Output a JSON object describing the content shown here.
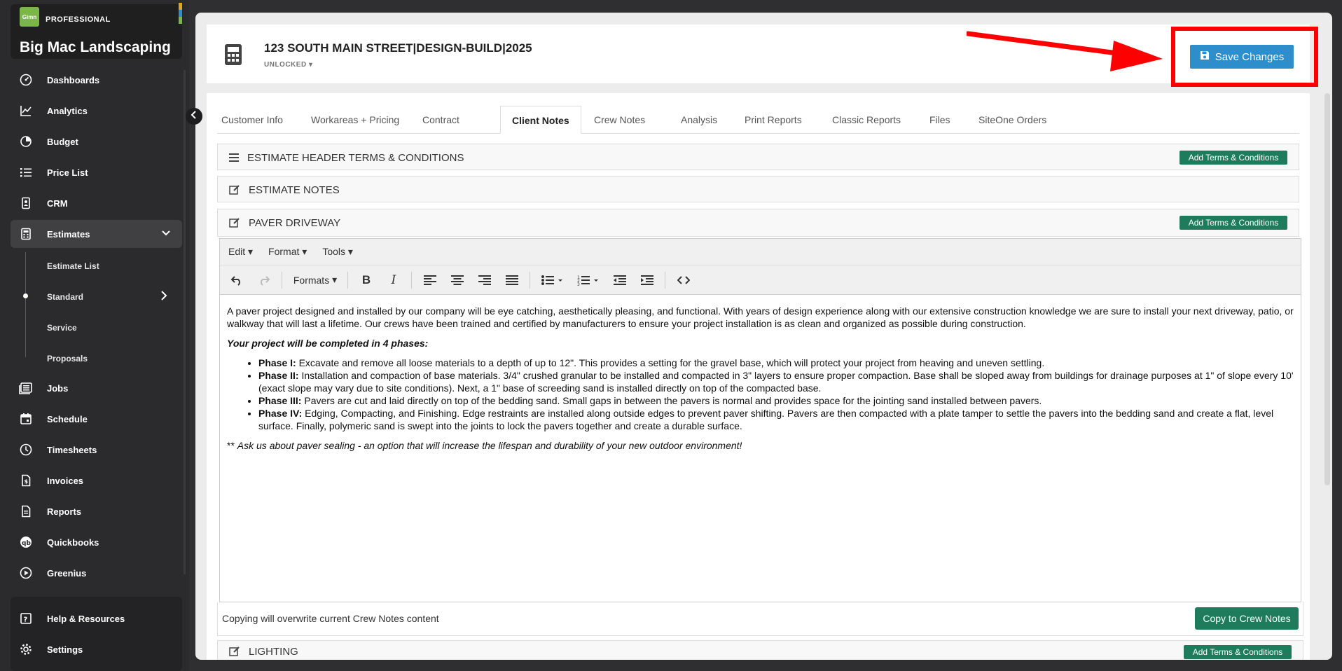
{
  "brand": {
    "logo_text": "Gimn",
    "tier": "PROFESSIONAL",
    "company": "Big Mac Landscaping",
    "colors": [
      "#e7a21b",
      "#2e8dcb",
      "#7ab648"
    ]
  },
  "nav": {
    "items": [
      {
        "label": "Dashboards",
        "icon": "gauge-icon"
      },
      {
        "label": "Analytics",
        "icon": "line-chart-icon"
      },
      {
        "label": "Budget",
        "icon": "pie-chart-icon"
      },
      {
        "label": "Price List",
        "icon": "list-icon"
      },
      {
        "label": "CRM",
        "icon": "contact-icon"
      },
      {
        "label": "Estimates",
        "icon": "calculator-icon"
      },
      {
        "label": "Jobs",
        "icon": "stack-icon"
      },
      {
        "label": "Schedule",
        "icon": "calendar-icon"
      },
      {
        "label": "Timesheets",
        "icon": "clock-icon"
      },
      {
        "label": "Invoices",
        "icon": "invoice-icon"
      },
      {
        "label": "Reports",
        "icon": "report-icon"
      },
      {
        "label": "Quickbooks",
        "icon": "quickbooks-icon"
      },
      {
        "label": "Greenius",
        "icon": "play-circle-icon"
      }
    ],
    "estimate_sub": [
      "Estimate List",
      "Standard",
      "Service",
      "Proposals"
    ],
    "bottom": [
      {
        "label": "Help & Resources",
        "icon": "help-icon"
      },
      {
        "label": "Settings",
        "icon": "gear-icon"
      }
    ]
  },
  "header": {
    "title": "123 SOUTH MAIN STREET|DESIGN-BUILD|2025",
    "status": "UNLOCKED",
    "save_label": "Save Changes"
  },
  "tabs": [
    {
      "label": "Customer Info"
    },
    {
      "label": "Workareas + Pricing"
    },
    {
      "label": "Contract"
    },
    {
      "label": "Client Notes"
    },
    {
      "label": "Crew Notes"
    },
    {
      "label": "Analysis"
    },
    {
      "label": "Print Reports"
    },
    {
      "label": "Classic Reports"
    },
    {
      "label": "Files"
    },
    {
      "label": "SiteOne Orders"
    }
  ],
  "sections": {
    "terms": {
      "title": "ESTIMATE HEADER TERMS & CONDITIONS",
      "button": "Add Terms & Conditions"
    },
    "notes": {
      "title": "ESTIMATE NOTES"
    },
    "paver": {
      "title": "PAVER DRIVEWAY",
      "button": "Add Terms & Conditions"
    },
    "lighting": {
      "title": "LIGHTING",
      "button": "Add Terms & Conditions"
    }
  },
  "editor": {
    "menus": [
      "Edit",
      "Format",
      "Tools"
    ],
    "formats_label": "Formats",
    "intro": "A paver project designed and installed by our company will be eye catching, aesthetically pleasing, and functional. With years of design experience along with our extensive construction knowledge we are sure to install your next driveway, patio, or walkway that will last a lifetime.  Our crews have been trained and certified by manufacturers to ensure your project installation is as clean and organized as possible during construction.",
    "phases_heading": "Your project will be completed in 4 phases:",
    "phases": [
      {
        "name": "Phase I:",
        "text": "  Excavate and remove all loose materials to a depth of up to 12\".  This provides a setting for the gravel base, which will protect your project from heaving and uneven settling."
      },
      {
        "name": "Phase II:",
        "text": "  Installation and compaction of base materials.  3/4\" crushed granular to be installed and compacted in 3\" layers to ensure proper compaction.  Base shall be sloped away from buildings for drainage purposes at 1\" of slope every 10' (exact slope may vary due to site conditions).  Next, a 1\" base of screeding sand is installed directly on top of the compacted base."
      },
      {
        "name": "Phase III:",
        "text": " Pavers are cut and laid directly on top of the bedding sand.  Small gaps in between the pavers is normal and provides space for the jointing sand installed between pavers."
      },
      {
        "name": "Phase IV:",
        "text": " Edging, Compacting, and Finishing.  Edge restraints are installed along outside edges to prevent paver shifting.  Pavers are then compacted with a plate tamper to settle the pavers into the bedding sand and create a flat, level surface.  Finally, polymeric sand is swept into the joints to lock the pavers together and create a durable surface."
      }
    ],
    "closing_prefix": "** ",
    "closing": "Ask us about paver sealing - an option that will increase the lifespan and durability of your new outdoor environment!"
  },
  "copy": {
    "note": "Copying will overwrite current Crew Notes content",
    "button": "Copy to Crew Notes"
  }
}
